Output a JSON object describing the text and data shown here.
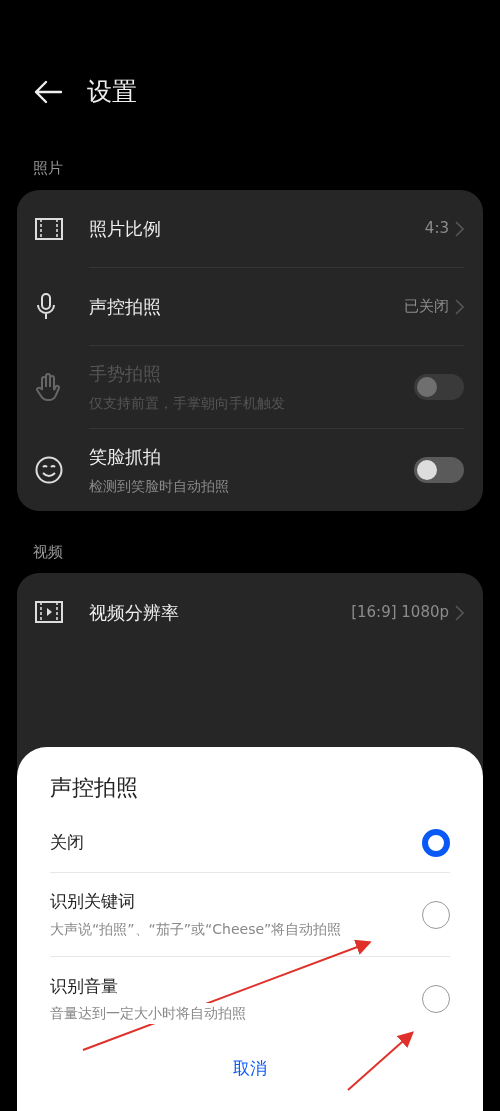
{
  "header": {
    "title": "设置"
  },
  "sections": [
    {
      "label": "照片",
      "rows": [
        {
          "kind": "link",
          "title": "照片比例",
          "value": "4:3"
        },
        {
          "kind": "link",
          "title": "声控拍照",
          "value": "已关闭"
        },
        {
          "kind": "toggle",
          "title": "手势拍照",
          "subtitle": "仅支持前置，手掌朝向手机触发",
          "on": false,
          "disabled": true
        },
        {
          "kind": "toggle",
          "title": "笑脸抓拍",
          "subtitle": "检测到笑脸时自动拍照",
          "on": false,
          "disabled": false
        }
      ]
    },
    {
      "label": "视频",
      "rows": [
        {
          "kind": "link",
          "title": "视频分辨率",
          "value": "[16:9] 1080p"
        }
      ]
    }
  ],
  "dialog": {
    "title": "声控拍照",
    "options": [
      {
        "label": "关闭",
        "selected": true
      },
      {
        "label": "识别关键词",
        "subtitle": "大声说“拍照”、“茄子”或“Cheese”将自动拍照",
        "selected": false
      },
      {
        "label": "识别音量",
        "subtitle": "音量达到一定大小时将自动拍照",
        "selected": false
      }
    ],
    "cancel": "取消"
  }
}
